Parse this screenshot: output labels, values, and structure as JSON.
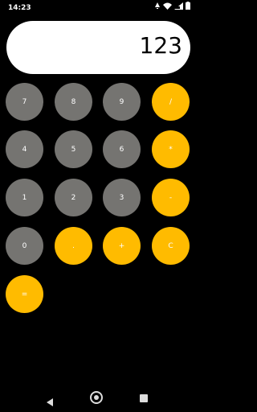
{
  "status_bar": {
    "time": "14:23",
    "icons": [
      "notification-icon",
      "wifi-icon",
      "signal-icon",
      "battery-icon"
    ]
  },
  "display": {
    "value": "123"
  },
  "keys": {
    "k7": "7",
    "k8": "8",
    "k9": "9",
    "div": "/",
    "k4": "4",
    "k5": "5",
    "k6": "6",
    "mul": "*",
    "k1": "1",
    "k2": "2",
    "k3": "3",
    "sub": "-",
    "k0": "0",
    "dot": ".",
    "add": "+",
    "clear": "C",
    "eq": "="
  },
  "colors": {
    "background": "#000000",
    "number_key": "#757471",
    "operator_key": "#ffbb00",
    "display_bg": "#ffffff"
  },
  "nav": {
    "icons": [
      "back-icon",
      "home-icon",
      "recents-icon"
    ]
  }
}
